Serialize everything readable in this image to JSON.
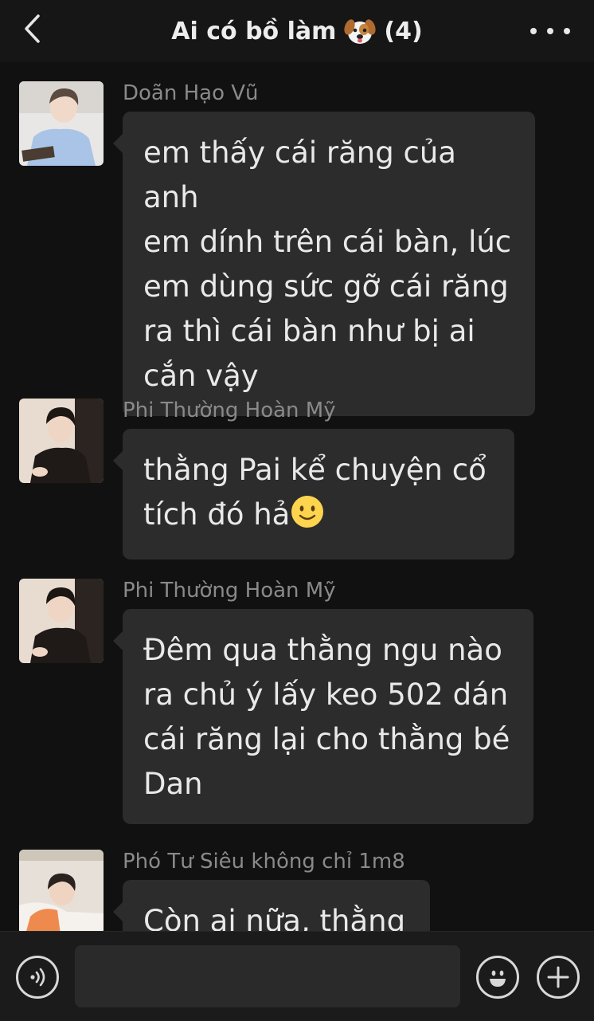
{
  "header": {
    "title_text": "Ai có bồ làm",
    "title_count": "(4)",
    "back_icon": "chevron-left-icon",
    "more_icon": "more-dots-icon"
  },
  "messages": [
    {
      "sender": "Doãn Hạo Vũ",
      "lines": [
        "em thấy cái răng của anh",
        "em dính trên cái bàn, lúc",
        "em dùng sức gỡ cái răng",
        "ra thì cái bàn như bị ai",
        "cắn vậy"
      ]
    },
    {
      "sender": "Phi Thường Hoàn Mỹ",
      "lines": [
        "thằng Pai kể chuyện cổ",
        "tích đó hả"
      ],
      "trailing_emoji": "slightly-smiling-face"
    },
    {
      "sender": "Phi Thường Hoàn Mỹ",
      "lines": [
        "Đêm qua thằng ngu nào",
        "ra chủ ý lấy keo 502 dán",
        "cái răng lại cho thằng bé",
        "Dan"
      ]
    },
    {
      "sender": "Phó Tư Siêu không chỉ 1m8",
      "lines": [
        "Còn ai nữa, thằng"
      ]
    }
  ],
  "bottombar": {
    "input_value": "",
    "voice_icon": "voice-icon",
    "emoji_icon": "emoji-icon",
    "plus_icon": "plus-icon"
  },
  "colors": {
    "background": "#111111",
    "bubble": "#2c2c2c",
    "sender_text": "#8a8a8a",
    "message_text": "#e9e9e9"
  }
}
